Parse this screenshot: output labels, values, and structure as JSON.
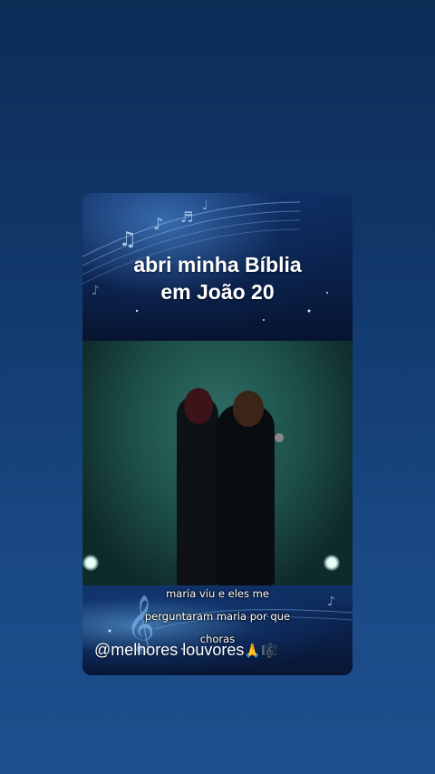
{
  "overlay": {
    "title_line1": "abri minha Bíblia",
    "title_line2": "em João 20"
  },
  "subtitle": {
    "line1": "maria viu e eles me",
    "line2": "perguntaram maria por que",
    "line3": "choras"
  },
  "watermark": {
    "handle": "@melhores louvores",
    "emoji": "🙏🎼"
  },
  "colors": {
    "background": "#153f77",
    "card_top": "#0f2e63",
    "video_green": "#2f6f66"
  }
}
